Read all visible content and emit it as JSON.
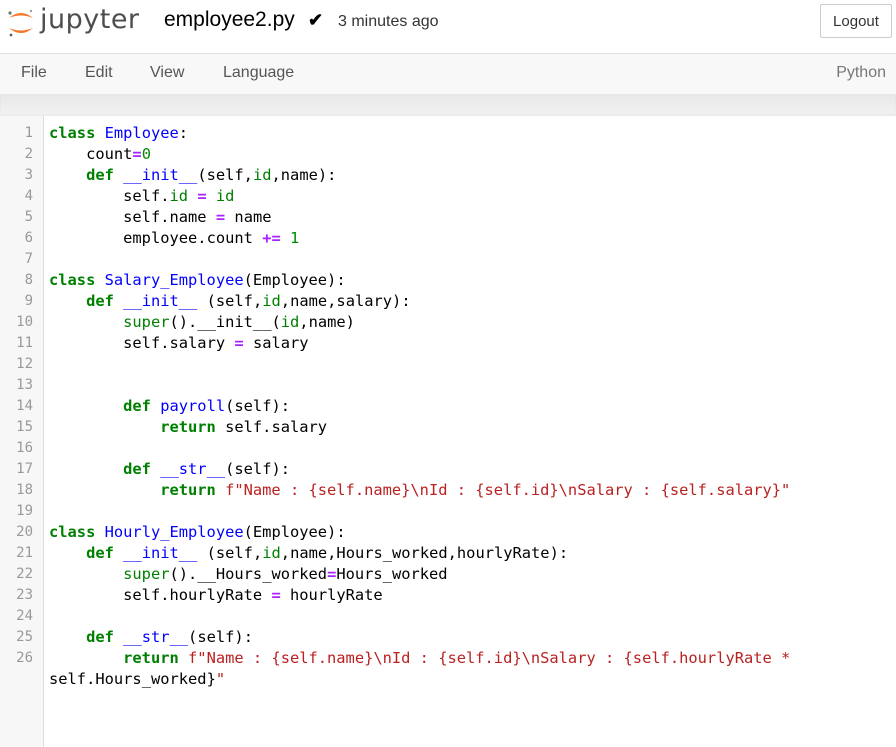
{
  "header": {
    "logo_text": "jupyter",
    "filename": "employee2.py",
    "checkmark": "✔",
    "saved_status": "3 minutes ago",
    "logout_label": "Logout"
  },
  "menu": {
    "items": [
      "File",
      "Edit",
      "View",
      "Language"
    ],
    "kernel": "Python"
  },
  "editor": {
    "line_numbers": [
      "1",
      "2",
      "3",
      "4",
      "5",
      "6",
      "7",
      "8",
      "9",
      "10",
      "11",
      "12",
      "13",
      "14",
      "15",
      "16",
      "17",
      "18",
      "19",
      "20",
      "21",
      "22",
      "23",
      "24",
      "25",
      "26"
    ],
    "lines": [
      "class Employee:",
      "    count=0",
      "    def __init__(self,id,name):",
      "        self.id = id",
      "        self.name = name",
      "        employee.count += 1",
      "",
      "class Salary_Employee(Employee):",
      "    def __init__ (self,id,name,salary):",
      "        super().__init__(id,name)",
      "        self.salary = salary",
      "",
      "",
      "        def payroll(self):",
      "            return self.salary",
      "",
      "        def __str__(self):",
      "            return f\"Name : {self.name}\\nId : {self.id}\\nSalary : {self.salary}\"",
      "",
      "class Hourly_Employee(Employee):",
      "    def __init__ (self,id,name,Hours_worked,hourlyRate):",
      "        super().__Hours_worked=Hours_worked",
      "        self.hourlyRate = hourlyRate",
      "",
      "    def __str__(self):",
      "        return f\"Name : {self.name}\\nId : {self.id}\\nSalary : {self.hourlyRate *",
      "self.Hours_worked}\""
    ]
  },
  "colors": {
    "keyword": "#008000",
    "definition": "#0000ff",
    "operator": "#aa22ff",
    "string": "#ba2121",
    "logo_orange": "#f37726"
  }
}
